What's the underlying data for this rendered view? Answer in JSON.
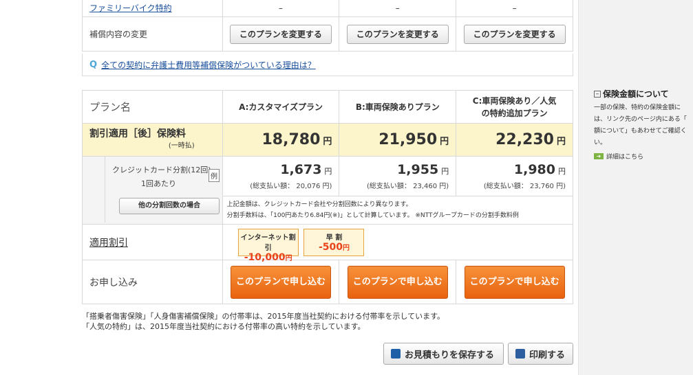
{
  "top_table": {
    "rows": [
      {
        "label": "ファミリーバイク特約",
        "cells": [
          "–",
          "–",
          "–"
        ]
      },
      {
        "label": "補償内容の変更",
        "button": "このプランを変更する"
      }
    ]
  },
  "faq": {
    "icon": "Q",
    "link": "全ての契約に弁護士費用等補償保険がついている理由は？"
  },
  "plans": {
    "header_label": "プラン名",
    "names": [
      "A:カスタマイズプラン",
      "B:車両保険ありプラン",
      "C:車両保険あり／人気の特約追加プラン"
    ],
    "price_label": "割引適用［後］保険料",
    "price_sub": "(一時払)",
    "prices": [
      "18,780",
      "21,950",
      "22,230"
    ],
    "yen": "円",
    "cc_label_1": "クレジットカード分割(12回)",
    "cc_label_2": "1回あたり",
    "rei": "例",
    "other_button": "他の分割回数の場合",
    "monthly": [
      "1,673",
      "1,955",
      "1,980"
    ],
    "totals": [
      "(総支払い額： 20,076 円)",
      "(総支払い額： 23,460 円)",
      "(総支払い額： 23,760 円)"
    ],
    "note_1": "上記金額は、クレジットカード会社や分割回数により異なります。",
    "note_2": "分割手数料は、「100円あたり6.84円(※)」として計算しています。 ※NTTグループカードの分割手数料例",
    "discount_label": "適用割引",
    "discounts": [
      {
        "title": "インターネット割引",
        "value": "-10,000",
        "yen": "円"
      },
      {
        "title": "早 割",
        "value": "-500",
        "yen": "円"
      }
    ],
    "apply_label": "お申し込み",
    "apply_button": "このプランで申し込む"
  },
  "footnotes": [
    "「搭乗者傷害保険」「人身傷害補償保険」の付帯率は、2015年度当社契約における付帯率を示しています。",
    "「人気の特約」は、2015年度当社契約における付帯率の高い特約を示しています。"
  ],
  "actions": {
    "save": "お見積もりを保存する",
    "print": "印刷する"
  },
  "sidebar": {
    "box_icon": "–",
    "title": "保険金額について",
    "lines": [
      "一部の保険、特約の保険金額に",
      "は、リンク先のページ内にある「",
      "額について」もあわせてご確認く",
      "い。"
    ],
    "arrow": "➜",
    "link": "詳細はこちら"
  }
}
